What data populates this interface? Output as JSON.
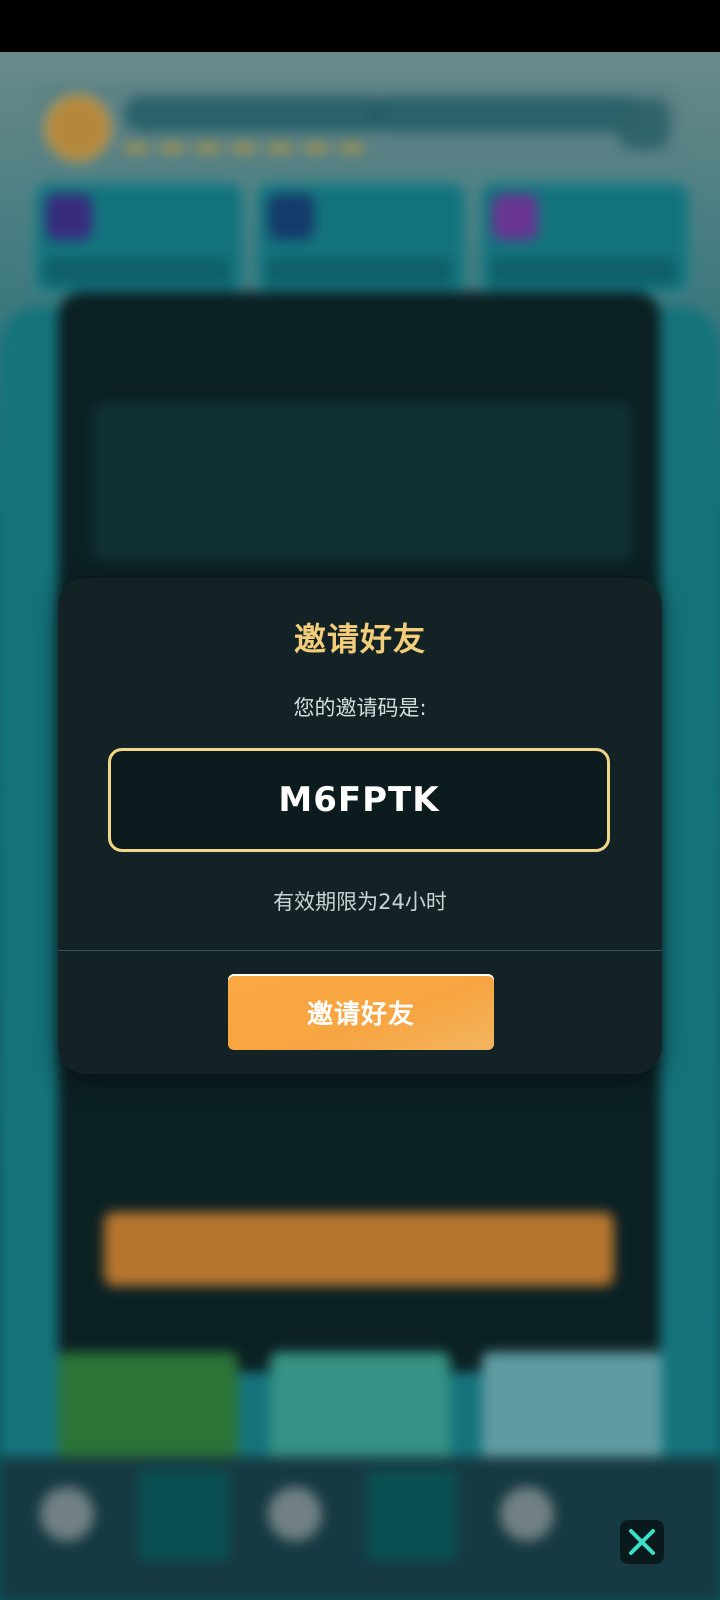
{
  "dialog": {
    "title": "邀请好友",
    "code_label": "您的邀请码是:",
    "invite_code": "M6FPTK",
    "expiry_note": "有效期限为24小时",
    "invite_button_label": "邀请好友"
  },
  "colors": {
    "accent_gold": "#f3cd7a",
    "button_orange": "#f7a542",
    "dialog_bg": "#142224",
    "close_icon": "#39e0c6"
  },
  "icons": [
    "close-icon"
  ]
}
